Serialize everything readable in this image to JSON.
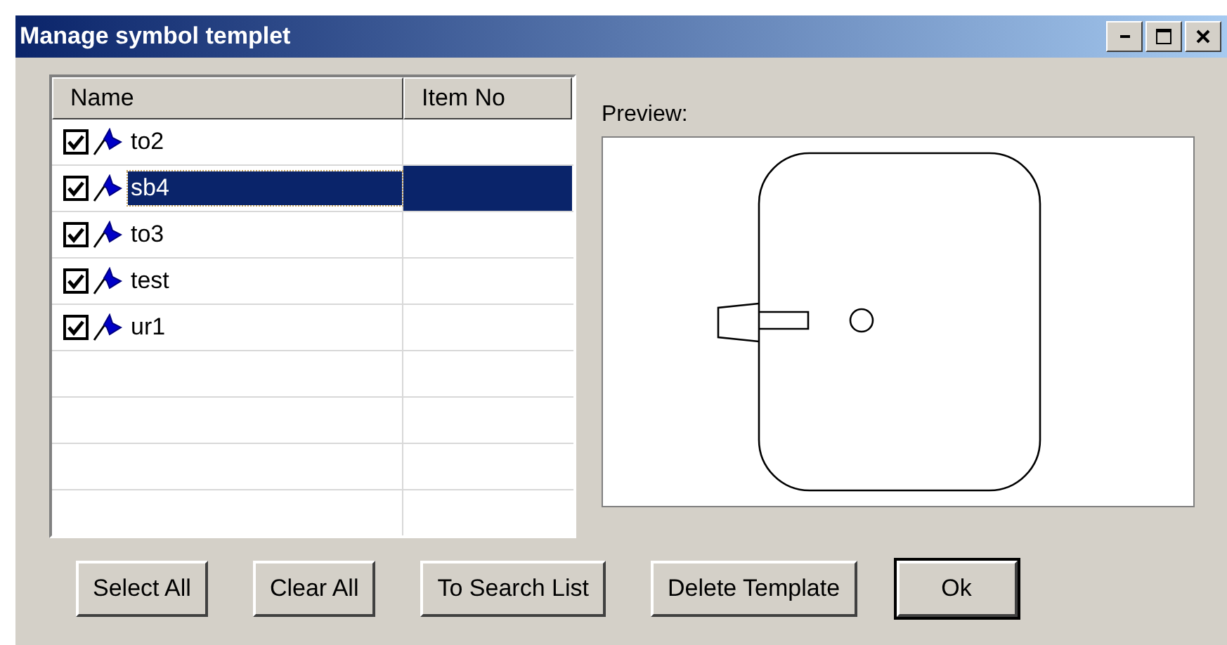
{
  "window": {
    "title": "Manage symbol templet"
  },
  "list": {
    "columns": [
      "Name",
      "Item No"
    ],
    "rows": [
      {
        "name": "to2",
        "checked": true,
        "selected": false
      },
      {
        "name": "sb4",
        "checked": true,
        "selected": true
      },
      {
        "name": "to3",
        "checked": true,
        "selected": false
      },
      {
        "name": "test",
        "checked": true,
        "selected": false
      },
      {
        "name": "ur1",
        "checked": true,
        "selected": false
      }
    ]
  },
  "preview": {
    "label": "Preview:"
  },
  "buttons": [
    {
      "label": "Select All",
      "default": false
    },
    {
      "label": "Clear All",
      "default": false
    },
    {
      "label": "To Search List",
      "default": false
    },
    {
      "label": "Delete Template",
      "default": false
    },
    {
      "label": "Ok",
      "default": true
    }
  ]
}
